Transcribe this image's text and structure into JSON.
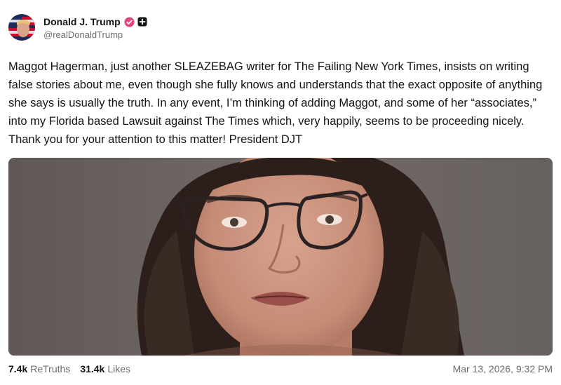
{
  "author": {
    "display_name": "Donald J. Trump",
    "handle": "@realDonaldTrump",
    "verified_icon": "verified-badge-icon",
    "extra_icon": "plus-badge-icon",
    "verified_color": "#e0457b"
  },
  "post": {
    "text": "Maggot Hagerman, just another SLEAZEBAG writer for The Failing New York Times, insists on writing false stories about me, even though she fully knows and understands that the exact opposite of anything she says is usually the truth. In any event, I’m thinking of adding Maggot, and some of her “associates,” into my Florida based Lawsuit against The Times which, very happily, seems to be proceeding nicely. Thank you for your attention to this matter! President DJT"
  },
  "stats": {
    "retruths_count": "7.4k",
    "retruths_label": "ReTruths",
    "likes_count": "31.4k",
    "likes_label": "Likes"
  },
  "timestamp": "Mar 13, 2026, 9:32 PM"
}
